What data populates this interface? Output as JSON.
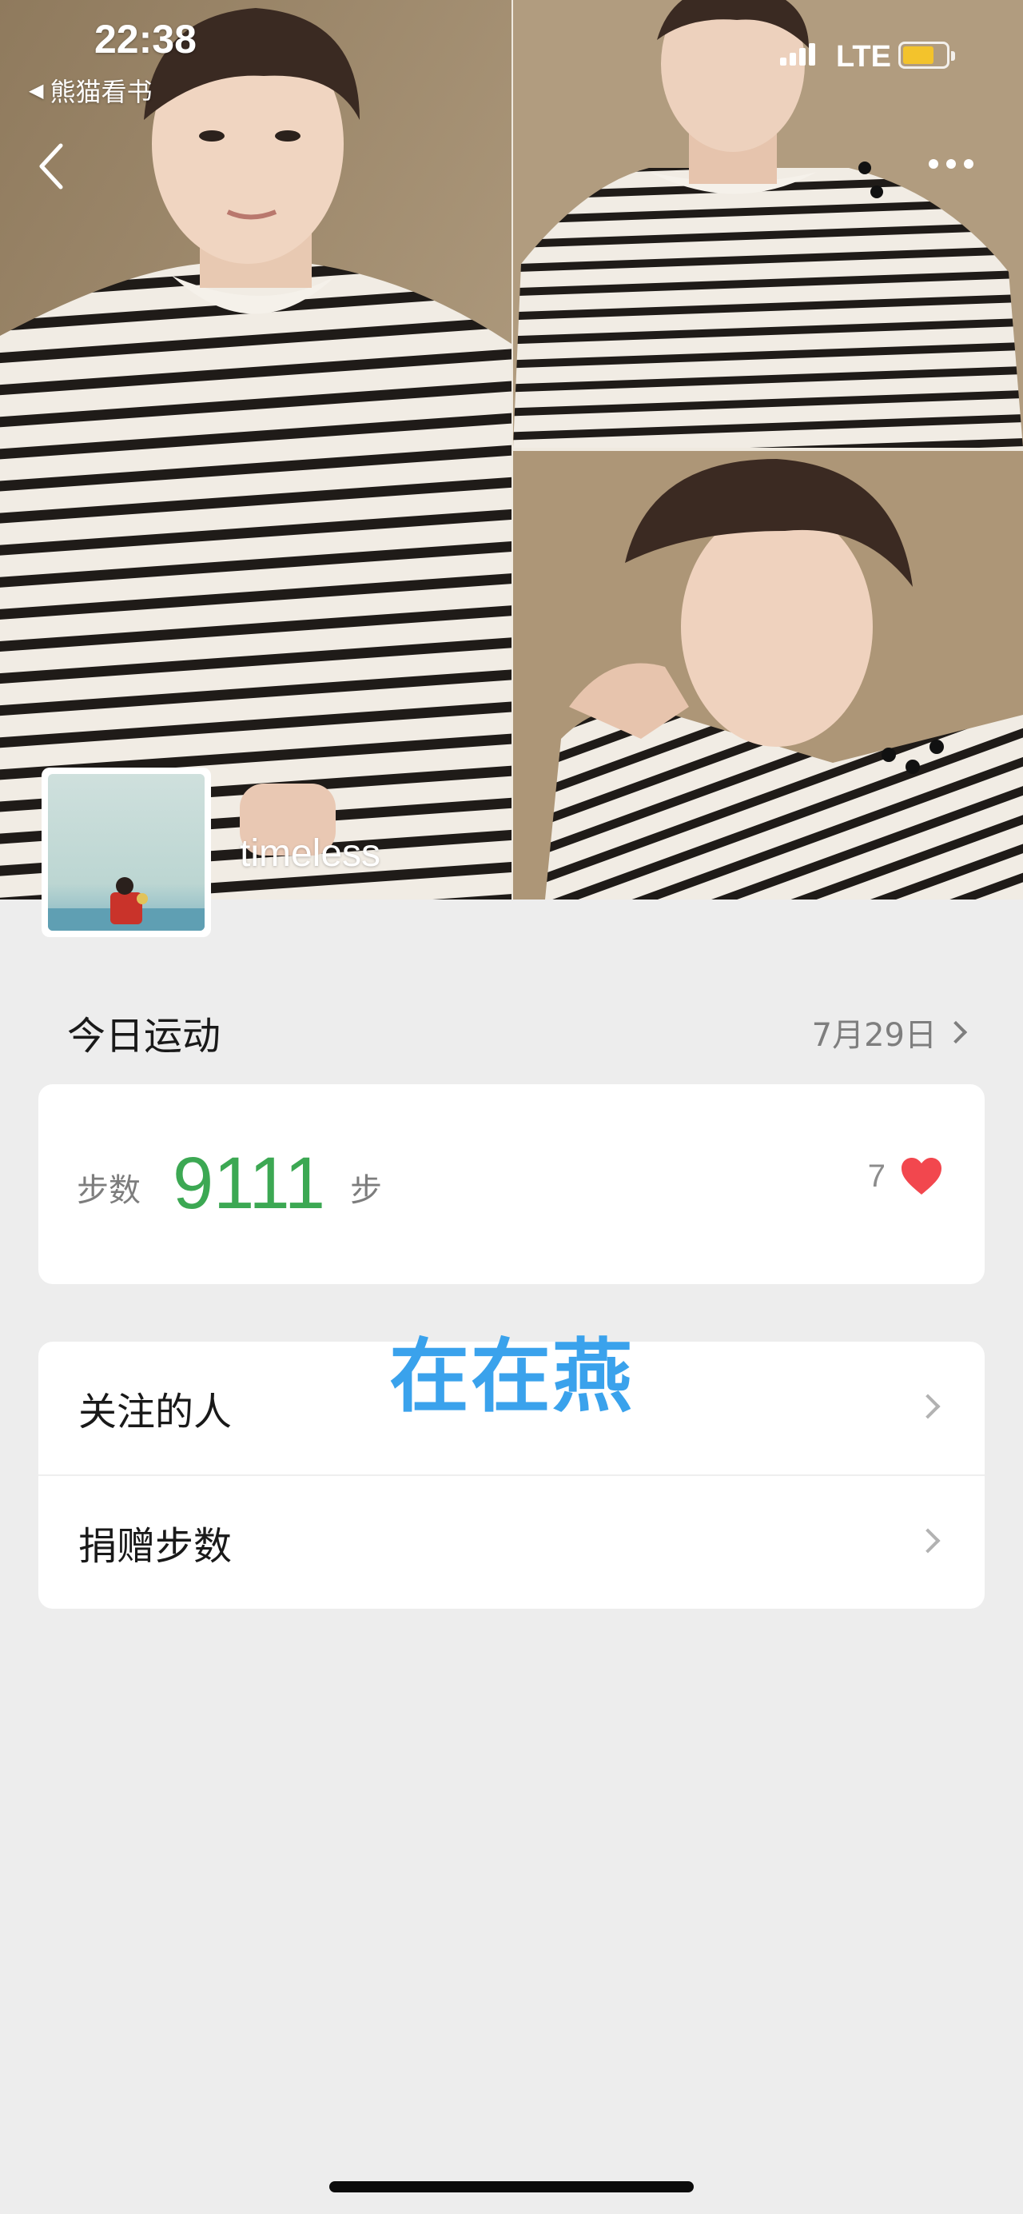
{
  "status_bar": {
    "time": "22:38",
    "back_app": "熊猫看书",
    "network": "LTE"
  },
  "cover": {
    "nickname": "timeless"
  },
  "today": {
    "title": "今日运动",
    "date": "7月29日"
  },
  "steps": {
    "label": "步数",
    "value": "9111",
    "unit": "步",
    "likes": "7"
  },
  "list": [
    {
      "label": "关注的人"
    },
    {
      "label": "捐赠步数"
    }
  ],
  "watermark": "在在燕",
  "colors": {
    "background": "#ededed",
    "steps_green": "#3ca853",
    "heart_red": "#f2474e",
    "watermark_blue": "#3aa2ec"
  }
}
